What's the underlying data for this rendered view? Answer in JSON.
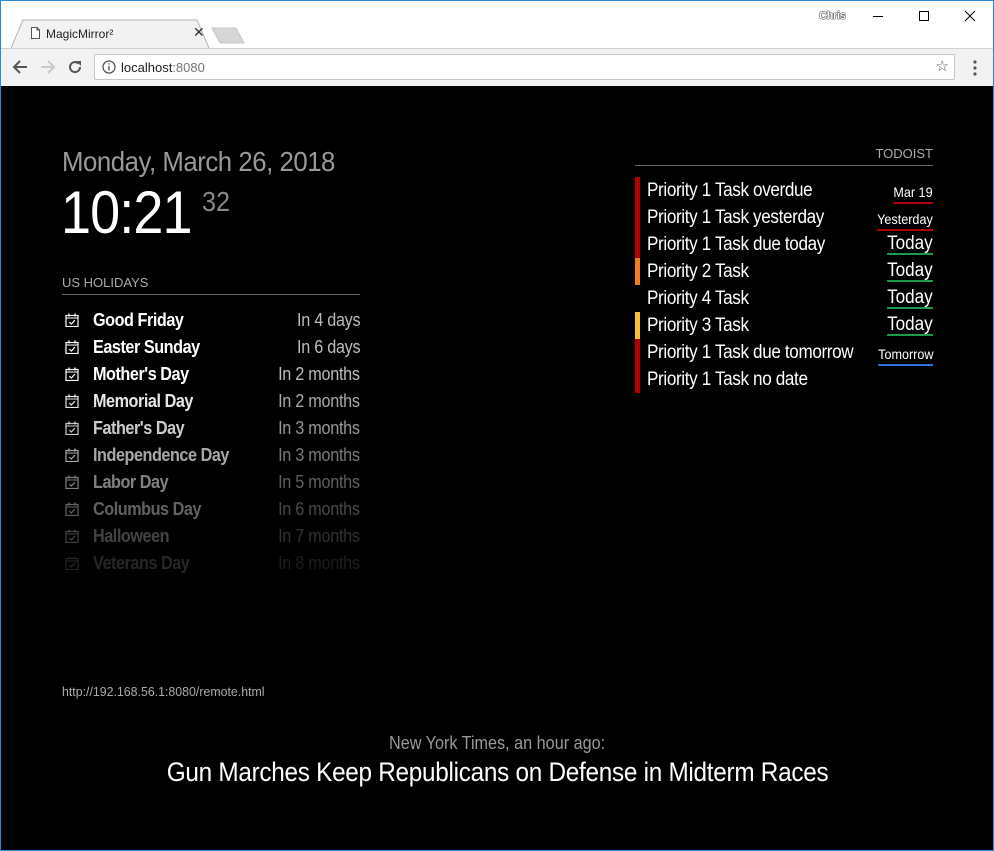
{
  "browser": {
    "tab_title": "MagicMirror²",
    "profile_name": "Chris",
    "url_host": "localhost",
    "url_port": ":8080"
  },
  "clock": {
    "date": "Monday, March 26, 2018",
    "time": "10:21",
    "seconds": "32"
  },
  "calendar": {
    "header": "US HOLIDAYS",
    "events": [
      {
        "name": "Good Friday",
        "when": "In 4 days",
        "opacity": 1.0
      },
      {
        "name": "Easter Sunday",
        "when": "In 6 days",
        "opacity": 1.0
      },
      {
        "name": "Mother's Day",
        "when": "In 2 months",
        "opacity": 1.0
      },
      {
        "name": "Memorial Day",
        "when": "In 2 months",
        "opacity": 0.9
      },
      {
        "name": "Father's Day",
        "when": "In 3 months",
        "opacity": 0.8
      },
      {
        "name": "Independence Day",
        "when": "In 3 months",
        "opacity": 0.65
      },
      {
        "name": "Labor Day",
        "when": "In 5 months",
        "opacity": 0.5
      },
      {
        "name": "Columbus Day",
        "when": "In 6 months",
        "opacity": 0.38
      },
      {
        "name": "Halloween",
        "when": "In 7 months",
        "opacity": 0.26
      },
      {
        "name": "Veterans Day",
        "when": "In 8 months",
        "opacity": 0.15
      }
    ]
  },
  "todoist": {
    "header": "TODOIST",
    "tasks": [
      {
        "task": "Priority 1 Task overdue",
        "due": "Mar 19",
        "priority_color": "#b30000",
        "due_color": "#b30000",
        "due_size": "small"
      },
      {
        "task": "Priority 1 Task yesterday",
        "due": "Yesterday",
        "priority_color": "#b30000",
        "due_color": "#b30000",
        "due_size": "small"
      },
      {
        "task": "Priority 1 Task due today",
        "due": "Today",
        "priority_color": "#b30000",
        "due_color": "#1e9a4b",
        "due_size": "large"
      },
      {
        "task": "Priority 2 Task",
        "due": "Today",
        "priority_color": "#f47b20",
        "due_color": "#1e9a4b",
        "due_size": "large"
      },
      {
        "task": "Priority 4 Task",
        "due": "Today",
        "priority_color": "#000000",
        "due_color": "#1e9a4b",
        "due_size": "large"
      },
      {
        "task": "Priority 3 Task",
        "due": "Today",
        "priority_color": "#fbc02d",
        "due_color": "#1e9a4b",
        "due_size": "large"
      },
      {
        "task": "Priority 1 Task due tomorrow",
        "due": "Tomorrow",
        "priority_color": "#b30000",
        "due_color": "#2f6fd6",
        "due_size": "small"
      },
      {
        "task": "Priority 1 Task no date",
        "due": "",
        "priority_color": "#b30000",
        "due_color": "",
        "due_size": "small"
      }
    ]
  },
  "remote": {
    "url": "http://192.168.56.1:8080/remote.html"
  },
  "news": {
    "source": "New York Times, an hour ago:",
    "headline": "Gun Marches Keep Republicans on Defense in Midterm Races"
  }
}
